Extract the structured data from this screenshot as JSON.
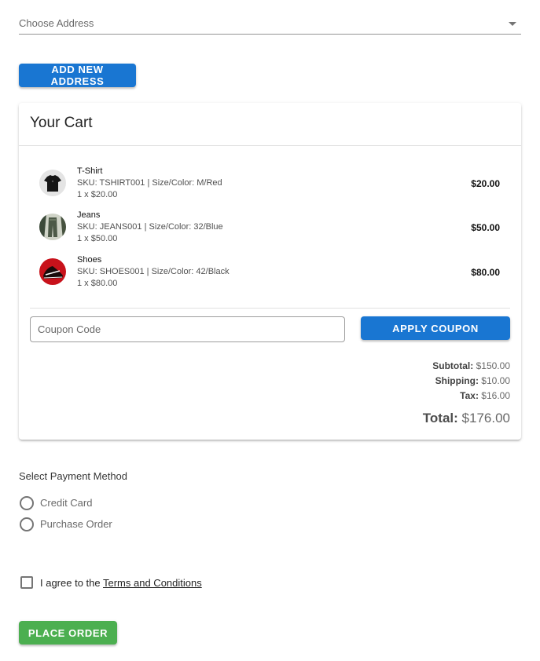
{
  "address": {
    "placeholder": "Choose Address",
    "icon": "arrow-drop-down-icon"
  },
  "add_address_button": "ADD NEW ADDRESS",
  "cart": {
    "title": "Your Cart",
    "items": [
      {
        "name": "T-Shirt",
        "meta": "SKU: TSHIRT001 | Size/Color: M/Red",
        "qty": "1 x $20.00",
        "price": "$20.00",
        "image": "tshirt-thumbnail"
      },
      {
        "name": "Jeans",
        "meta": "SKU: JEANS001 | Size/Color: 32/Blue",
        "qty": "1 x $50.00",
        "price": "$50.00",
        "image": "jeans-thumbnail"
      },
      {
        "name": "Shoes",
        "meta": "SKU: SHOES001 | Size/Color: 42/Black",
        "qty": "1 x $80.00",
        "price": "$80.00",
        "image": "shoes-thumbnail"
      }
    ],
    "coupon_placeholder": "Coupon Code",
    "apply_coupon_button": "APPLY COUPON",
    "summary": {
      "subtotal_label": "Subtotal:",
      "subtotal_value": "$150.00",
      "shipping_label": "Shipping:",
      "shipping_value": "$10.00",
      "tax_label": "Tax:",
      "tax_value": "$16.00",
      "total_label": "Total:",
      "total_value": "$176.00"
    }
  },
  "payment": {
    "title": "Select Payment Method",
    "options": [
      "Credit Card",
      "Purchase Order"
    ]
  },
  "terms": {
    "prefix": "I agree to the ",
    "link": "Terms and Conditions"
  },
  "place_order_button": "PLACE ORDER",
  "colors": {
    "primary": "#1976d2",
    "success": "#4caf50"
  }
}
